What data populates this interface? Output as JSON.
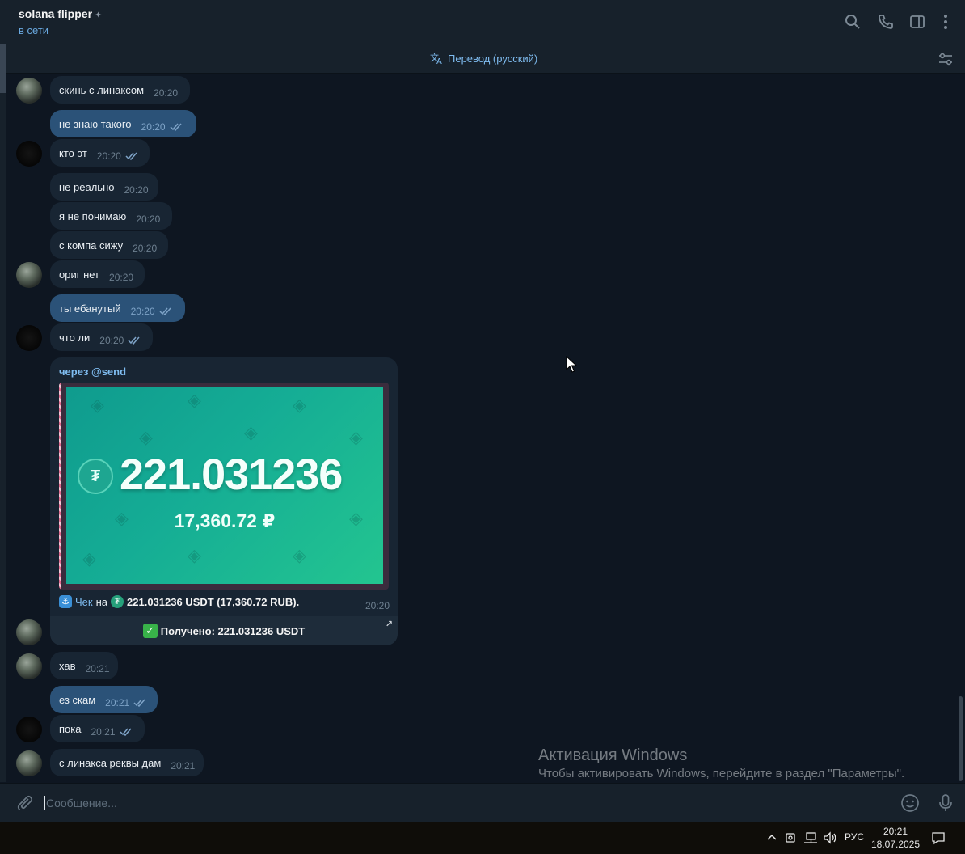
{
  "header": {
    "title": "solana flipper",
    "status": "в сети"
  },
  "translate_bar": {
    "label": "Перевод (русский)"
  },
  "messages": [
    {
      "text": "скинь с линаксом",
      "time": "20:20",
      "dir": "in"
    },
    {
      "text": "не знаю такого",
      "time": "20:20",
      "dir": "out"
    },
    {
      "text": "кто эт",
      "time": "20:20",
      "dir": "out-dark"
    },
    {
      "text": "не реально",
      "time": "20:20",
      "dir": "in"
    },
    {
      "text": "я не понимаю",
      "time": "20:20",
      "dir": "in"
    },
    {
      "text": "с компа сижу",
      "time": "20:20",
      "dir": "in"
    },
    {
      "text": "ориг нет",
      "time": "20:20",
      "dir": "in"
    },
    {
      "text": "ты ебанутый",
      "time": "20:20",
      "dir": "out"
    },
    {
      "text": "что ли",
      "time": "20:20",
      "dir": "out-dark"
    },
    {
      "text": "хав",
      "time": "20:21",
      "dir": "in"
    },
    {
      "text": "ез скам",
      "time": "20:21",
      "dir": "out"
    },
    {
      "text": "пока",
      "time": "20:21",
      "dir": "out-dark"
    },
    {
      "text": "с линакса реквы дам",
      "time": "20:21",
      "dir": "in"
    }
  ],
  "check_card": {
    "via": "через @send",
    "amount": "221.031236",
    "amount_rub": "17,360.72 ₽",
    "caption_prefix": "Чек",
    "caption_on": "на",
    "caption_value": "221.031236 USDT (17,360.72 RUB).",
    "time": "20:20",
    "button_label": "Получено: 221.031236 USDT"
  },
  "composer": {
    "placeholder": "Сообщение..."
  },
  "watermark": {
    "line1": "Активация Windows",
    "line2": "Чтобы активировать Windows, перейдите в раздел \"Параметры\"."
  },
  "taskbar": {
    "lang": "РУС",
    "time": "20:21",
    "date": "18.07.2025"
  },
  "colors": {
    "background": "#0e1621",
    "incoming_bubble": "#182533",
    "outgoing_bubble": "#2b5278",
    "accent": "#7fbcf0"
  },
  "icons": [
    "search-icon",
    "phone-icon",
    "sidebar-toggle-icon",
    "more-icon",
    "translate-icon",
    "filter-icon",
    "attach-icon",
    "emoji-icon",
    "microphone-icon"
  ]
}
